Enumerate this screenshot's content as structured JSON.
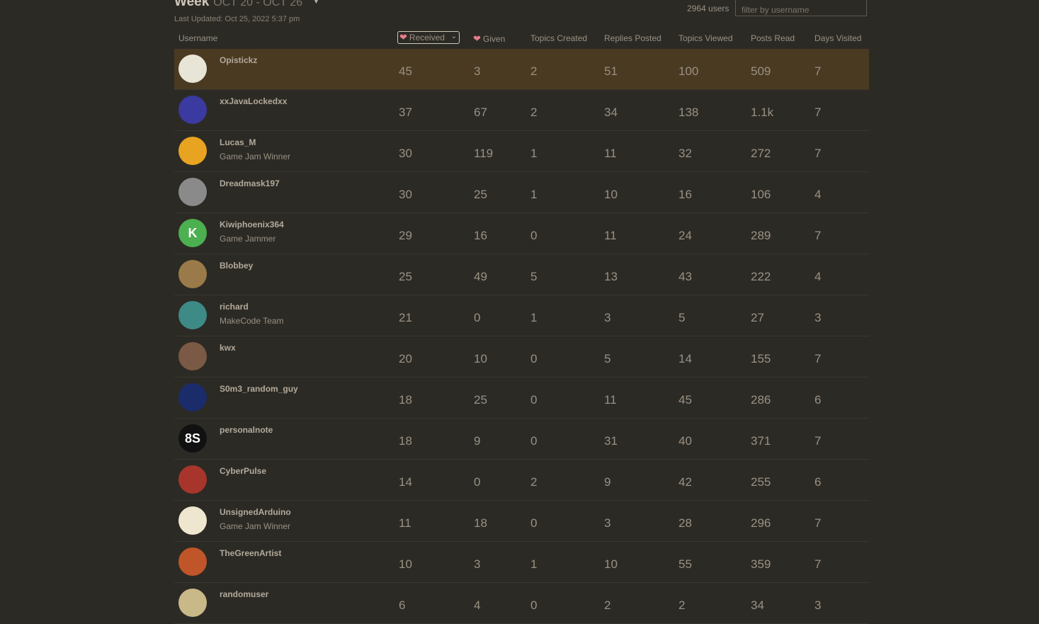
{
  "header": {
    "period_label": "Week",
    "date_range": "OCT 20 - OCT 26",
    "last_updated": "Last Updated: Oct 25, 2022 5:37 pm",
    "users_count": "2964 users",
    "filter_placeholder": "filter by username"
  },
  "columns": {
    "username": "Username",
    "received": "Received",
    "given": "Given",
    "topics_created": "Topics Created",
    "replies_posted": "Replies Posted",
    "topics_viewed": "Topics Viewed",
    "posts_read": "Posts Read",
    "days_visited": "Days Visited"
  },
  "colors": {
    "highlight_row": "#4a3a22",
    "heart": "#e97c8c",
    "background": "#2c2a25"
  },
  "users": [
    {
      "name": "Opistickz",
      "title": "",
      "avatar_icon": "opistickz-avatar",
      "avatar_text": "",
      "avatar_color": "#e8e4d6",
      "received": "45",
      "given": "3",
      "topics_created": "2",
      "replies_posted": "51",
      "topics_viewed": "100",
      "posts_read": "509",
      "days_visited": "7"
    },
    {
      "name": "xxJavaLockedxx",
      "title": "",
      "avatar_icon": "face-avatar",
      "avatar_text": "",
      "avatar_color": "#3b3aa0",
      "received": "37",
      "given": "67",
      "topics_created": "2",
      "replies_posted": "34",
      "topics_viewed": "138",
      "posts_read": "1.1k",
      "days_visited": "7"
    },
    {
      "name": "Lucas_M",
      "title": "Game Jam Winner",
      "avatar_icon": "cartoon-avatar",
      "avatar_text": "",
      "avatar_color": "#e8a320",
      "received": "30",
      "given": "119",
      "topics_created": "1",
      "replies_posted": "11",
      "topics_viewed": "32",
      "posts_read": "272",
      "days_visited": "7"
    },
    {
      "name": "Dreadmask197",
      "title": "",
      "avatar_icon": "mask-avatar",
      "avatar_text": "",
      "avatar_color": "#8a8a8a",
      "received": "30",
      "given": "25",
      "topics_created": "1",
      "replies_posted": "10",
      "topics_viewed": "16",
      "posts_read": "106",
      "days_visited": "4"
    },
    {
      "name": "Kiwiphoenix364",
      "title": "Game Jammer",
      "avatar_icon": "letter-avatar",
      "avatar_text": "K",
      "avatar_color": "#4caf50",
      "received": "29",
      "given": "16",
      "topics_created": "0",
      "replies_posted": "11",
      "topics_viewed": "24",
      "posts_read": "289",
      "days_visited": "7"
    },
    {
      "name": "Blobbey",
      "title": "",
      "avatar_icon": "bird-avatar",
      "avatar_text": "",
      "avatar_color": "#9a7a48",
      "received": "25",
      "given": "49",
      "topics_created": "5",
      "replies_posted": "13",
      "topics_viewed": "43",
      "posts_read": "222",
      "days_visited": "4"
    },
    {
      "name": "richard",
      "title": "MakeCode Team",
      "avatar_icon": "creature-avatar",
      "avatar_text": "",
      "avatar_color": "#3d8a86",
      "received": "21",
      "given": "0",
      "topics_created": "1",
      "replies_posted": "3",
      "topics_viewed": "5",
      "posts_read": "27",
      "days_visited": "3"
    },
    {
      "name": "kwx",
      "title": "",
      "avatar_icon": "photo-avatar",
      "avatar_text": "",
      "avatar_color": "#7a5a44",
      "received": "20",
      "given": "10",
      "topics_created": "0",
      "replies_posted": "5",
      "topics_viewed": "14",
      "posts_read": "155",
      "days_visited": "7"
    },
    {
      "name": "S0m3_random_guy",
      "title": "",
      "avatar_icon": "space-avatar",
      "avatar_text": "",
      "avatar_color": "#1b2c6a",
      "received": "18",
      "given": "25",
      "topics_created": "0",
      "replies_posted": "11",
      "topics_viewed": "45",
      "posts_read": "286",
      "days_visited": "6"
    },
    {
      "name": "personalnote",
      "title": "",
      "avatar_icon": "text-avatar",
      "avatar_text": "8S",
      "avatar_color": "#111111",
      "received": "18",
      "given": "9",
      "topics_created": "0",
      "replies_posted": "31",
      "topics_viewed": "40",
      "posts_read": "371",
      "days_visited": "7"
    },
    {
      "name": "CyberPulse",
      "title": "",
      "avatar_icon": "robot-avatar",
      "avatar_text": "",
      "avatar_color": "#a8352b",
      "received": "14",
      "given": "0",
      "topics_created": "2",
      "replies_posted": "9",
      "topics_viewed": "42",
      "posts_read": "255",
      "days_visited": "6"
    },
    {
      "name": "UnsignedArduino",
      "title": "Game Jam Winner",
      "avatar_icon": "logo-avatar",
      "avatar_text": "",
      "avatar_color": "#efe6cf",
      "received": "11",
      "given": "18",
      "topics_created": "0",
      "replies_posted": "3",
      "topics_viewed": "28",
      "posts_read": "296",
      "days_visited": "7"
    },
    {
      "name": "TheGreenArtist",
      "title": "",
      "avatar_icon": "character-avatar",
      "avatar_text": "",
      "avatar_color": "#c0552a",
      "received": "10",
      "given": "3",
      "topics_created": "1",
      "replies_posted": "10",
      "topics_viewed": "55",
      "posts_read": "359",
      "days_visited": "7"
    },
    {
      "name": "randomuser",
      "title": "",
      "avatar_icon": "sprite-avatar",
      "avatar_text": "",
      "avatar_color": "#c9b888",
      "received": "6",
      "given": "4",
      "topics_created": "0",
      "replies_posted": "2",
      "topics_viewed": "2",
      "posts_read": "34",
      "days_visited": "3"
    }
  ]
}
